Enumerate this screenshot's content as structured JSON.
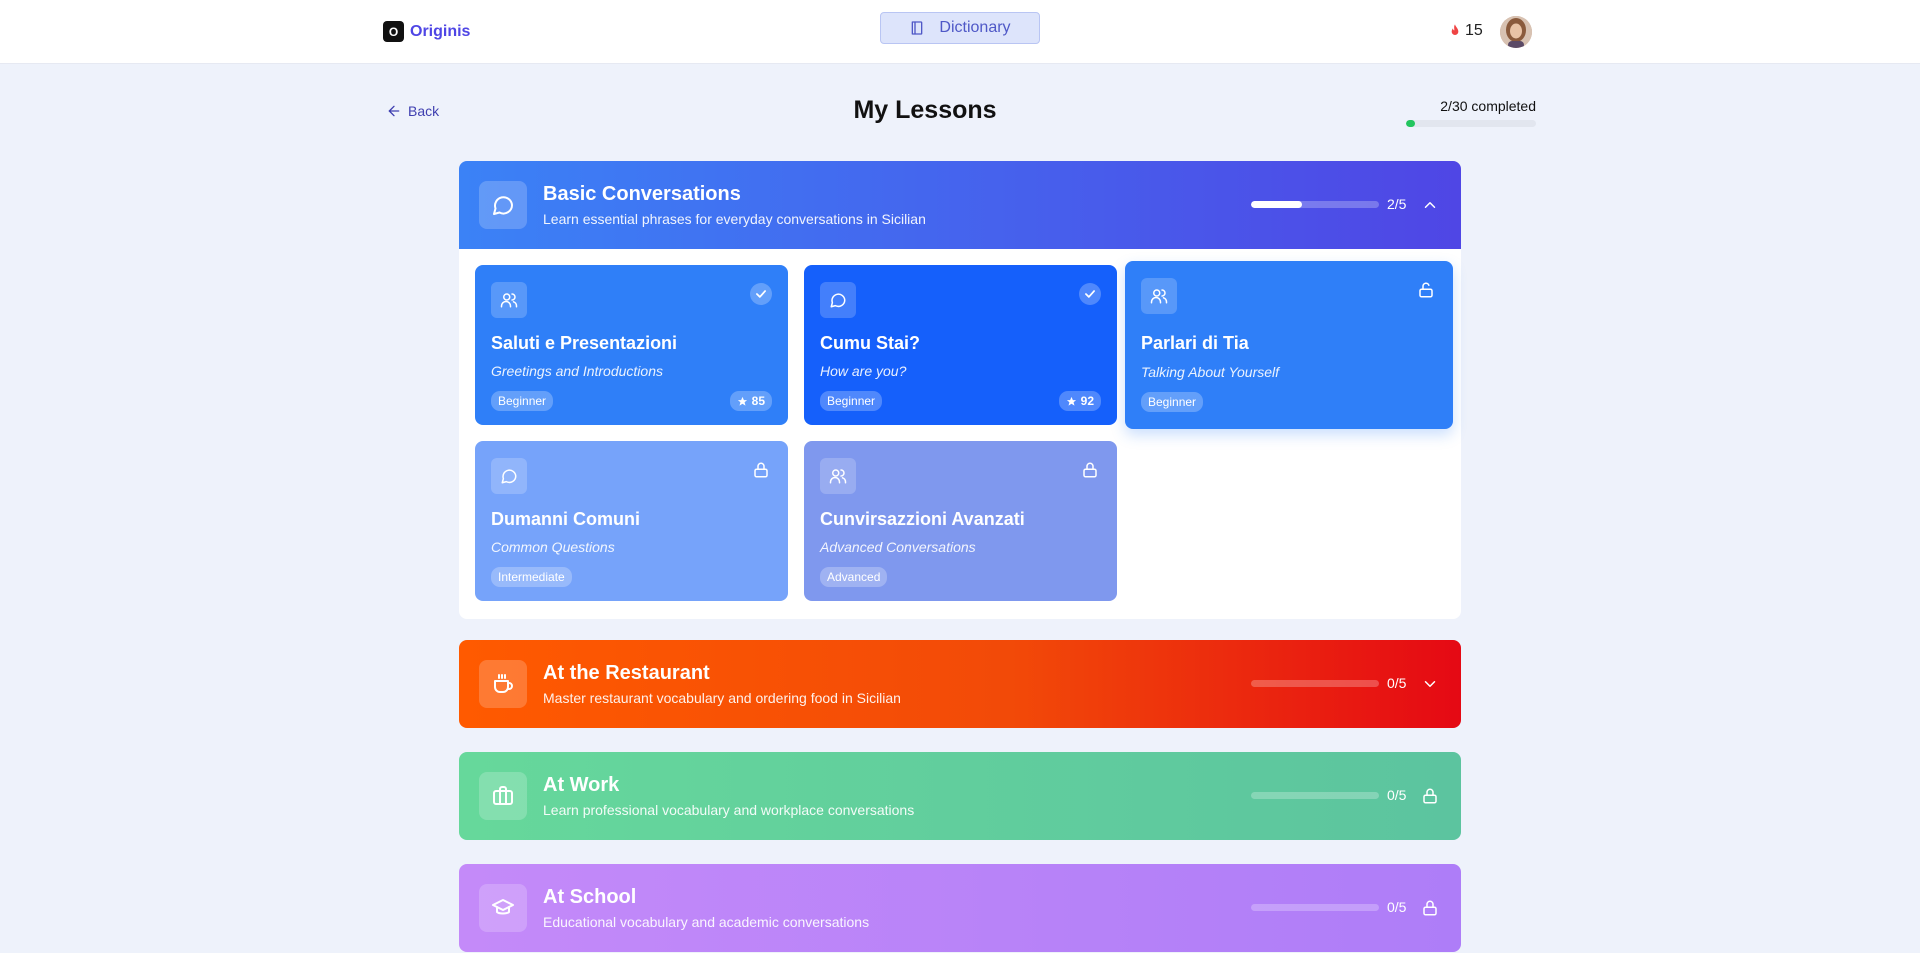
{
  "header": {
    "brand_mark": "O",
    "brand_name": "Originis",
    "dictionary_label": "Dictionary",
    "streak_count": "15"
  },
  "subheader": {
    "back_label": "Back",
    "title": "My Lessons",
    "progress_text": "2/30 completed",
    "progress_fraction": 0.067
  },
  "modules": [
    {
      "title": "Basic Conversations",
      "description": "Learn essential phrases for everyday conversations in Sicilian",
      "count": "2/5",
      "progress_fraction": 0.4,
      "lessons": [
        {
          "title": "Saluti e Presentazioni",
          "subtitle": "Greetings and Introductions",
          "level": "Beginner",
          "score": "85",
          "status": "completed",
          "icon": "users-icon"
        },
        {
          "title": "Cumu Stai?",
          "subtitle": "How are you?",
          "level": "Beginner",
          "score": "92",
          "status": "completed",
          "icon": "chat-icon"
        },
        {
          "title": "Parlari di Tia",
          "subtitle": "Talking About Yourself",
          "level": "Beginner",
          "status": "unlocked",
          "icon": "users-icon"
        },
        {
          "title": "Dumanni Comuni",
          "subtitle": "Common Questions",
          "level": "Intermediate",
          "status": "locked",
          "icon": "chat-icon"
        },
        {
          "title": "Cunvirsazzioni Avanzati",
          "subtitle": "Advanced Conversations",
          "level": "Advanced",
          "status": "locked",
          "icon": "users-icon"
        }
      ]
    },
    {
      "title": "At the Restaurant",
      "description": "Master restaurant vocabulary and ordering food in Sicilian",
      "count": "0/5",
      "progress_fraction": 0,
      "icon": "coffee-icon",
      "state": "collapsed"
    },
    {
      "title": "At Work",
      "description": "Learn professional vocabulary and workplace conversations",
      "count": "0/5",
      "progress_fraction": 0,
      "icon": "briefcase-icon",
      "state": "locked"
    },
    {
      "title": "At School",
      "description": "Educational vocabulary and academic conversations",
      "count": "0/5",
      "progress_fraction": 0,
      "icon": "graduation-cap-icon",
      "state": "locked"
    }
  ],
  "colors": {
    "brand": "#4f46e5",
    "module_blue_start": "#3b82f6",
    "module_blue_end": "#4f46e5",
    "module_red_start": "#ff5a00",
    "module_red_end": "#e50914",
    "module_green": "#5fcf9a",
    "module_purple": "#b688f7",
    "progress_green": "#22c55e"
  }
}
